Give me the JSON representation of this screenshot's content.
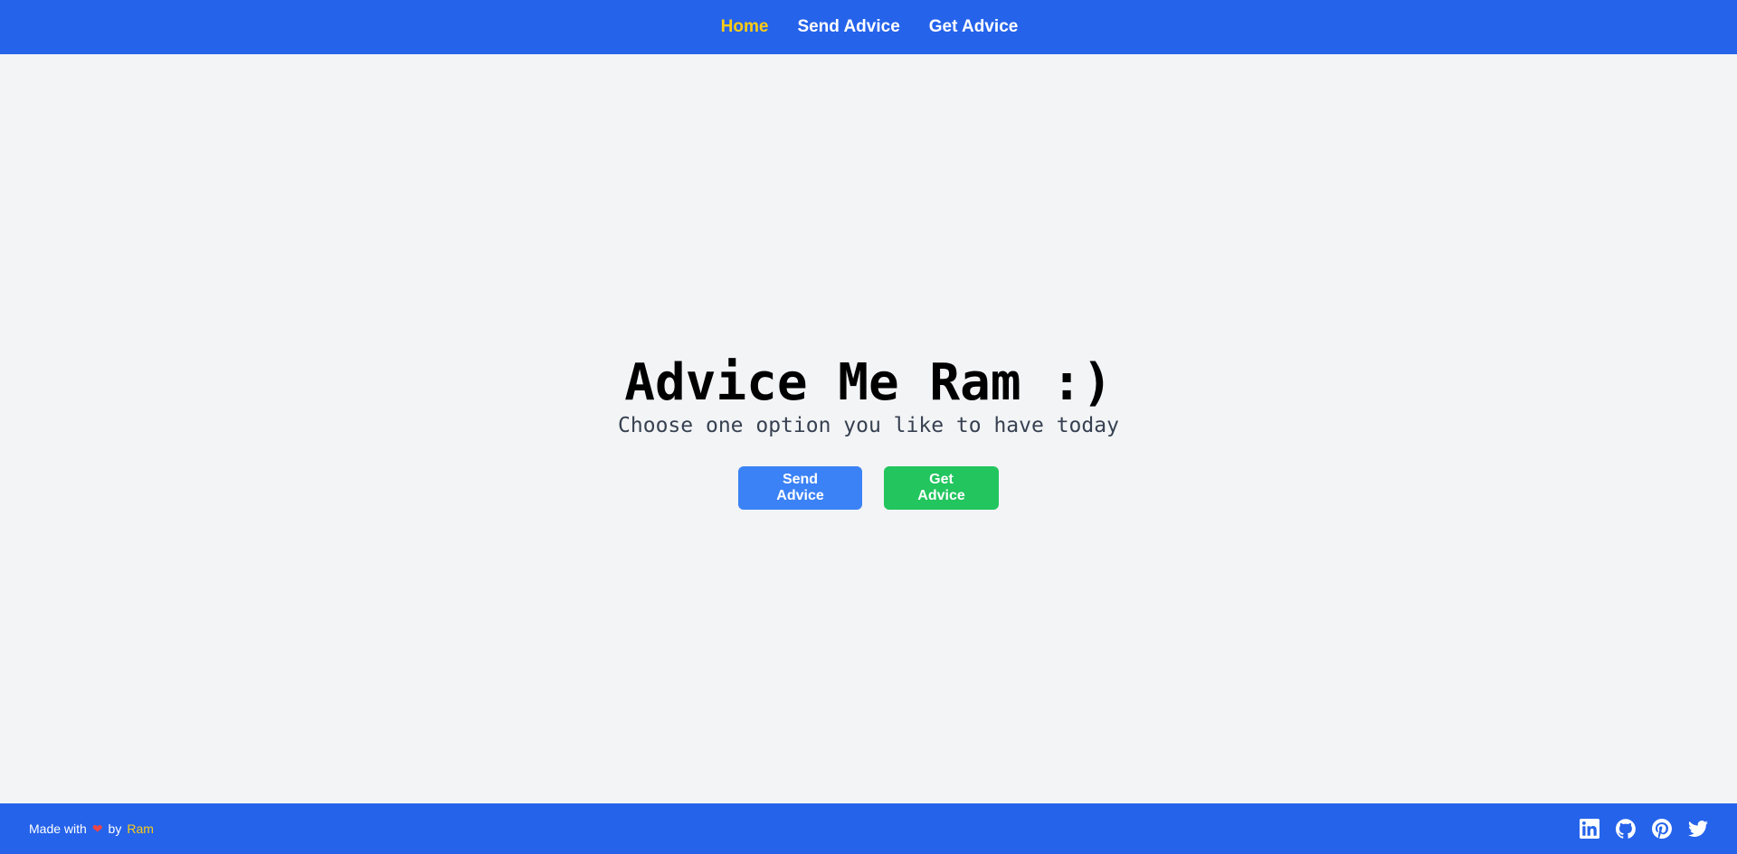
{
  "nav": {
    "items": [
      {
        "label": "Home",
        "active": true
      },
      {
        "label": "Send Advice",
        "active": false
      },
      {
        "label": "Get Advice",
        "active": false
      }
    ],
    "active_color": "#facc15"
  },
  "hero": {
    "title": "Advice Me Ram :)",
    "subtitle": "Choose one option you like to have today",
    "send_button": "Send Advice",
    "get_button": "Get Advice"
  },
  "footer": {
    "made_with": "Made with",
    "by": "by",
    "author": "Ram",
    "heart_icon": "heart-icon",
    "socials": [
      "linkedin-icon",
      "github-icon",
      "pinterest-icon",
      "twitter-icon"
    ]
  },
  "colors": {
    "primary": "#2563eb",
    "send": "#3b82f6",
    "get": "#22c55e",
    "background": "#f3f4f6"
  }
}
